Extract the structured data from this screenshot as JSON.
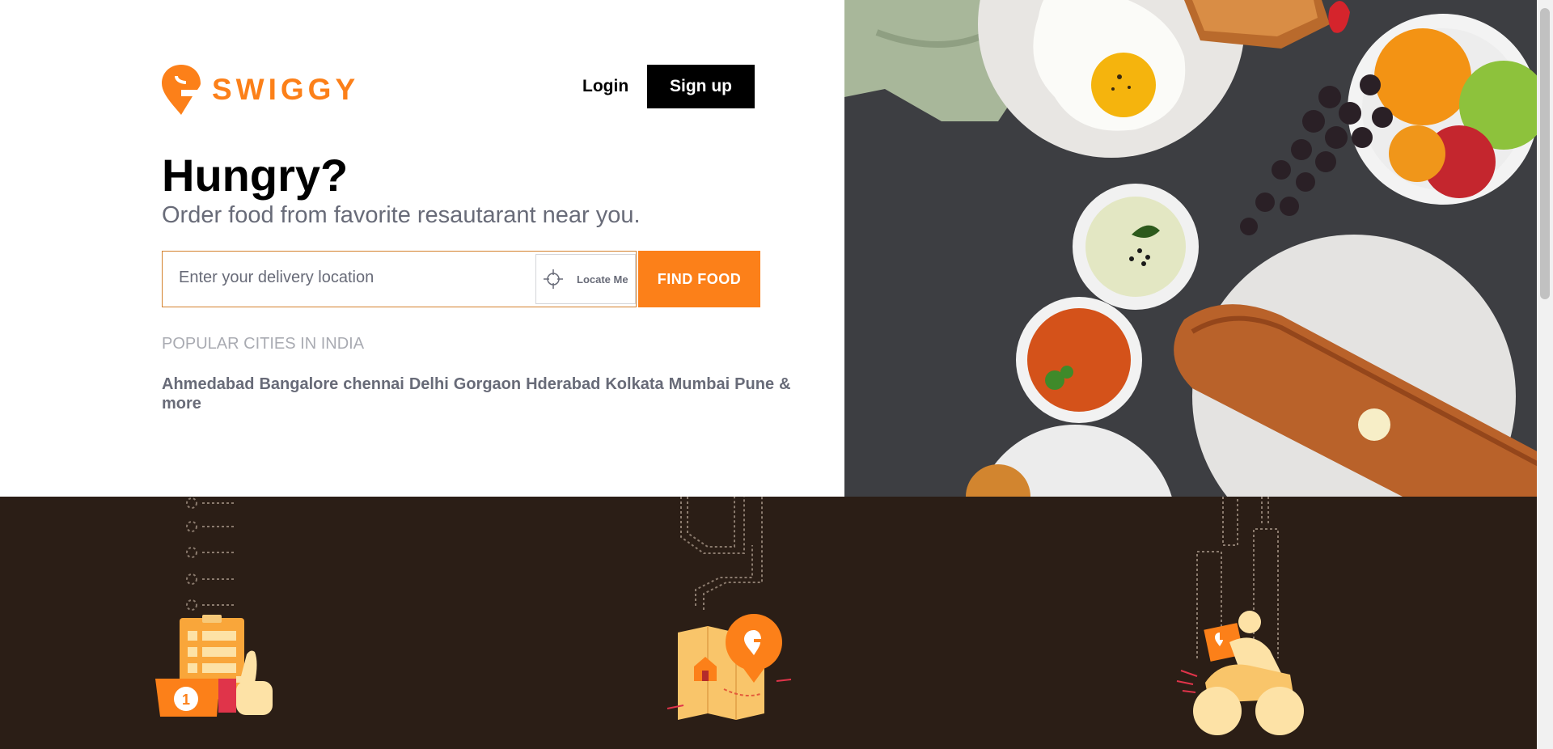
{
  "brand": {
    "name": "SWIGGY",
    "color": "#fc8019"
  },
  "header": {
    "login_label": "Login",
    "signup_label": "Sign up"
  },
  "hero": {
    "title": "Hungry?",
    "subtitle": "Order food from favorite resautarant near you.",
    "search": {
      "placeholder": "Enter your delivery location",
      "value": ""
    },
    "locate_label": "Locate Me",
    "find_label": "FIND FOOD"
  },
  "popular": {
    "title": "POPULAR CITIES IN INDIA",
    "cities": [
      "Ahmedabad",
      "Bangalore",
      "chennai",
      "Delhi",
      "Gorgaon",
      "Hderabad",
      "Kolkata",
      "Mumbai",
      "Pune"
    ],
    "more_label": "& more"
  },
  "features": [
    {
      "icon": "order-thumbs-up-icon"
    },
    {
      "icon": "map-location-icon"
    },
    {
      "icon": "delivery-scooter-icon"
    }
  ],
  "colors": {
    "accent": "#fc8019",
    "dark_band": "#2b1e16",
    "text_gray": "#686b78",
    "muted_gray": "#a9abb2"
  }
}
